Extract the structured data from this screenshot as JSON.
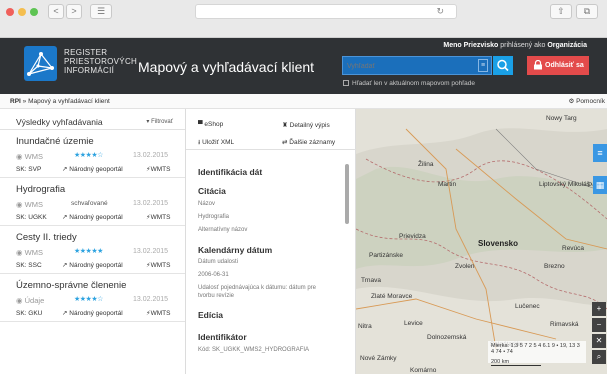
{
  "browser": {
    "back": "<",
    "forward": ">",
    "menu": "☰",
    "reload": "↻",
    "share": "⇧",
    "tabs": "⧉"
  },
  "header": {
    "brand_lines": [
      "REGISTER",
      "PRIESTOROVÝCH",
      "INFORMÁCIÍ"
    ],
    "title": "Mapový a vyhľadávací klient",
    "search_placeholder": "Vyhľadať",
    "search_stepper": "≡",
    "checkbox_label": "Hľadať len v aktuálnom mapovom pohľade",
    "user_name": "Meno Priezvisko",
    "user_mid": " prihlásený ako ",
    "user_org": "Organizácia",
    "logout": "Odhlásiť sa"
  },
  "breadcrumb": {
    "root": "RPI",
    "sep": " » ",
    "current": "Mapový a vyhľadávací klient",
    "feedback": "Pomocník"
  },
  "results": {
    "heading": "Výsledky vyhľadávania",
    "filter": "Filtrovať",
    "items": [
      {
        "title": "Inundačné územie",
        "type": "WMS",
        "stars": "★★★★☆",
        "status": "",
        "date": "13.02.2015",
        "code": "SK: SVP",
        "geo": "Národný geoportál",
        "wmts": "WMTS"
      },
      {
        "title": "Hydrografia",
        "type": "WMS",
        "stars": "",
        "status": "schvaľované",
        "date": "13.02.2015",
        "code": "SK: UGKK",
        "geo": "Národný geoportál",
        "wmts": "WMTS"
      },
      {
        "title": "Cesty II. triedy",
        "type": "WMS",
        "stars": "★★★★★",
        "status": "",
        "date": "13.02.2015",
        "code": "SK: SSC",
        "geo": "Národný geoportál",
        "wmts": "WMTS"
      },
      {
        "title": "Územno-správne členenie",
        "type": "Údaje",
        "stars": "★★★★☆",
        "status": "",
        "date": "13.02.2015",
        "code": "SK: GKU",
        "geo": "Národný geoportál",
        "wmts": "WMTS"
      }
    ]
  },
  "detail": {
    "tools": {
      "eshop": "eShop",
      "details": "Detailný výpis",
      "xml": "Uložiť XML",
      "more": "Ďalšie záznamy"
    },
    "heading": "Identifikácia dát",
    "citation": "Citácia",
    "citation_rows": [
      "Názov",
      "Hydrografia",
      "Alternatívny názov"
    ],
    "calendar": "Kalendárny dátum",
    "calendar_rows": [
      "Dátum udalosti",
      "2006-06-31",
      "Udalosť pojednávajúca k dátumu: dátum pre"
    ],
    "calendar_tail": "tvorbu revízie",
    "edition": "Edícia",
    "identifier": "Identifikátor",
    "identifier_val": "Kód: SK_UGKK_WMS2_HYDROGRAFIA"
  },
  "map": {
    "labels": [
      "Nowy Targ",
      "Žilina",
      "Martin",
      "Liptovský Mikuláš",
      "Poprad",
      "Prievidza",
      "Slovensko",
      "Revúca",
      "Partizánske",
      "Zvolen",
      "Brezno",
      "Trnava",
      "Zlaté Moravce",
      "Lučenec",
      "Nitra",
      "Levice",
      "Dolnozemská",
      "Nové Zámky",
      "Komárno",
      "Salgótarján",
      "Rimavská"
    ],
    "scale_text": "Mierka: 1:3 5 7 2 5 4 6.1 9 • 19, 13 3 4 74 • 74",
    "scale_bar": "200 km"
  }
}
